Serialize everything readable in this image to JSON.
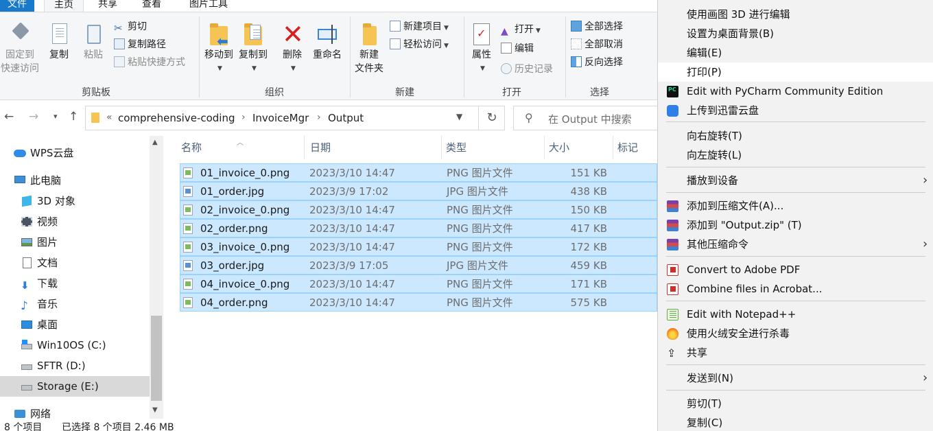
{
  "window": {
    "title": "Output"
  },
  "tabs": [
    {
      "label": "文件"
    },
    {
      "label": "主页"
    },
    {
      "label": "共享"
    },
    {
      "label": "查看"
    },
    {
      "label": "图片工具"
    }
  ],
  "ribbon": {
    "clipboard": {
      "group_label": "剪贴板",
      "pin_label_1": "固定到",
      "pin_label_2": "快速访问",
      "copy_label": "复制",
      "paste_label": "粘贴",
      "cut_label": "剪切",
      "copy_path_label": "复制路径",
      "paste_shortcut_label": "粘贴快捷方式"
    },
    "organize": {
      "group_label": "组织",
      "move_to_label": "移动到",
      "copy_to_label": "复制到",
      "delete_label": "删除",
      "rename_label": "重命名"
    },
    "new": {
      "group_label": "新建",
      "new_folder_label_1": "新建",
      "new_folder_label_2": "文件夹",
      "new_item_label": "新建项目",
      "easy_access_label": "轻松访问"
    },
    "open": {
      "group_label": "打开",
      "properties_label": "属性",
      "open_label": "打开",
      "edit_label": "编辑",
      "history_label": "历史记录"
    },
    "select": {
      "group_label": "选择",
      "select_all_label": "全部选择",
      "select_none_label": "全部取消",
      "invert_label": "反向选择"
    }
  },
  "address": {
    "overflow": "«",
    "crumbs": [
      "comprehensive-coding",
      "InvoiceMgr",
      "Output"
    ],
    "search_placeholder": "在 Output 中搜索"
  },
  "nav": {
    "items": [
      {
        "label": "WPS云盘",
        "icon": "cloud-icon"
      },
      {
        "label": "此电脑",
        "icon": "computer-icon"
      },
      {
        "label": "3D 对象",
        "icon": "cube-icon"
      },
      {
        "label": "视频",
        "icon": "film-icon"
      },
      {
        "label": "图片",
        "icon": "picture-icon"
      },
      {
        "label": "文档",
        "icon": "document-icon"
      },
      {
        "label": "下载",
        "icon": "download-icon"
      },
      {
        "label": "音乐",
        "icon": "music-icon"
      },
      {
        "label": "桌面",
        "icon": "desktop-icon"
      },
      {
        "label": "Win10OS (C:)",
        "icon": "windows-drive-icon"
      },
      {
        "label": "SFTR (D:)",
        "icon": "drive-icon"
      },
      {
        "label": "Storage (E:)",
        "icon": "drive-icon"
      },
      {
        "label": "网络",
        "icon": "network-icon"
      }
    ],
    "selected": "Storage (E:)"
  },
  "columns": {
    "name": "名称",
    "date": "日期",
    "type": "类型",
    "size": "大小",
    "tags": "标记"
  },
  "files": [
    {
      "name": "01_invoice_0.png",
      "date": "2023/3/10 14:47",
      "type": "PNG 图片文件",
      "size": "151 KB"
    },
    {
      "name": "01_order.jpg",
      "date": "2023/3/9 17:02",
      "type": "JPG 图片文件",
      "size": "438 KB"
    },
    {
      "name": "02_invoice_0.png",
      "date": "2023/3/10 14:47",
      "type": "PNG 图片文件",
      "size": "150 KB"
    },
    {
      "name": "02_order.png",
      "date": "2023/3/10 14:47",
      "type": "PNG 图片文件",
      "size": "417 KB"
    },
    {
      "name": "03_invoice_0.png",
      "date": "2023/3/10 14:47",
      "type": "PNG 图片文件",
      "size": "172 KB"
    },
    {
      "name": "03_order.jpg",
      "date": "2023/3/9 17:05",
      "type": "JPG 图片文件",
      "size": "459 KB"
    },
    {
      "name": "04_invoice_0.png",
      "date": "2023/3/10 14:47",
      "type": "PNG 图片文件",
      "size": "171 KB"
    },
    {
      "name": "04_order.png",
      "date": "2023/3/10 14:47",
      "type": "PNG 图片文件",
      "size": "575 KB"
    }
  ],
  "status": {
    "count": "8 个项目",
    "selection": "已选择 8 个项目 2.46 MB"
  },
  "context_menu": {
    "items": [
      {
        "label": "使用画图 3D 进行编辑",
        "icon": ""
      },
      {
        "label": "设置为桌面背景(B)",
        "icon": ""
      },
      {
        "label": "编辑(E)",
        "icon": ""
      },
      {
        "label": "打印(P)",
        "icon": "",
        "highlighted": true
      },
      {
        "label": "Edit with PyCharm Community Edition",
        "icon": "pycharm-icon"
      },
      {
        "label": "上传到迅雷云盘",
        "icon": "xunlei-icon"
      },
      {
        "label": "向右旋转(T)",
        "icon": ""
      },
      {
        "label": "向左旋转(L)",
        "icon": ""
      },
      {
        "label": "播放到设备",
        "icon": "",
        "submenu": true
      },
      {
        "label": "添加到压缩文件(A)...",
        "icon": "winrar-icon"
      },
      {
        "label": "添加到 \"Output.zip\" (T)",
        "icon": "winrar-icon"
      },
      {
        "label": "其他压缩命令",
        "icon": "winrar-icon",
        "submenu": true
      },
      {
        "label": "Convert to Adobe PDF",
        "icon": "acrobat-icon"
      },
      {
        "label": "Combine files in Acrobat...",
        "icon": "acrobat-icon"
      },
      {
        "label": "Edit with Notepad++",
        "icon": "notepadpp-icon"
      },
      {
        "label": "使用火绒安全进行杀毒",
        "icon": "huorong-icon"
      },
      {
        "label": "共享",
        "icon": "share-icon"
      },
      {
        "label": "发送到(N)",
        "icon": "",
        "submenu": true
      },
      {
        "label": "剪切(T)",
        "icon": ""
      },
      {
        "label": "复制(C)",
        "icon": ""
      }
    ]
  },
  "colors": {
    "accent": "#1979ca",
    "selection_bg": "#cce8ff",
    "selection_border": "#99d1ff",
    "menu_bg": "#f2f2f2"
  }
}
